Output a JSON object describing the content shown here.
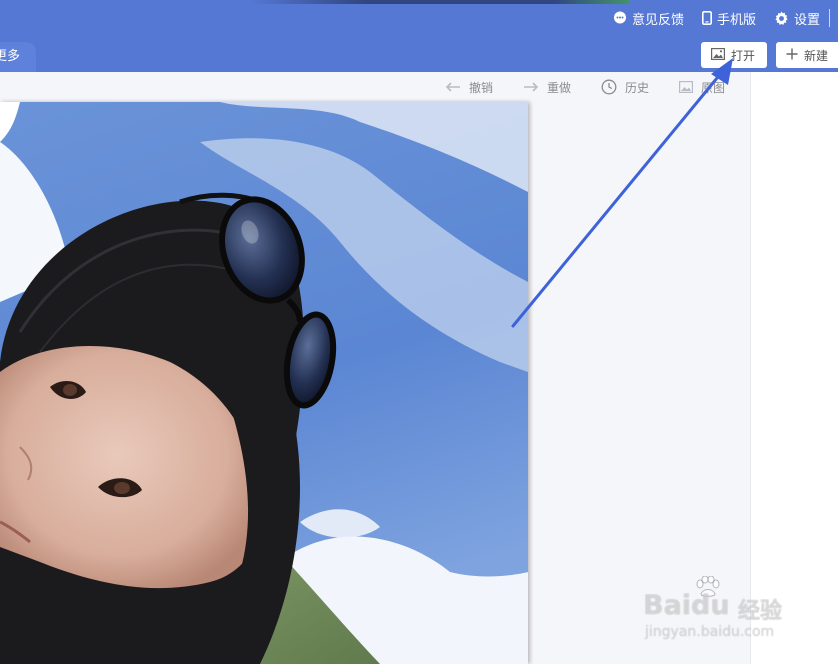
{
  "header": {
    "feedback_label": "意见反馈",
    "mobile_label": "手机版",
    "settings_label": "设置",
    "tab_label": "更多",
    "open_label": "打开",
    "new_label": "新建"
  },
  "toolbar": {
    "undo_label": "撤销",
    "redo_label": "重做",
    "history_label": "历史",
    "image_label": "原图"
  },
  "watermark": {
    "brand": "Baidu",
    "brand_cn": "经验",
    "url": "jingyan.baidu.com"
  },
  "colors": {
    "accent": "#5578d4",
    "annotation_arrow": "#3e63d8"
  },
  "icons": [
    "feedback-icon",
    "mobile-icon",
    "gear-icon",
    "image-icon",
    "plus-icon",
    "undo-arrow-icon",
    "redo-arrow-icon",
    "clock-icon",
    "image-icon"
  ]
}
